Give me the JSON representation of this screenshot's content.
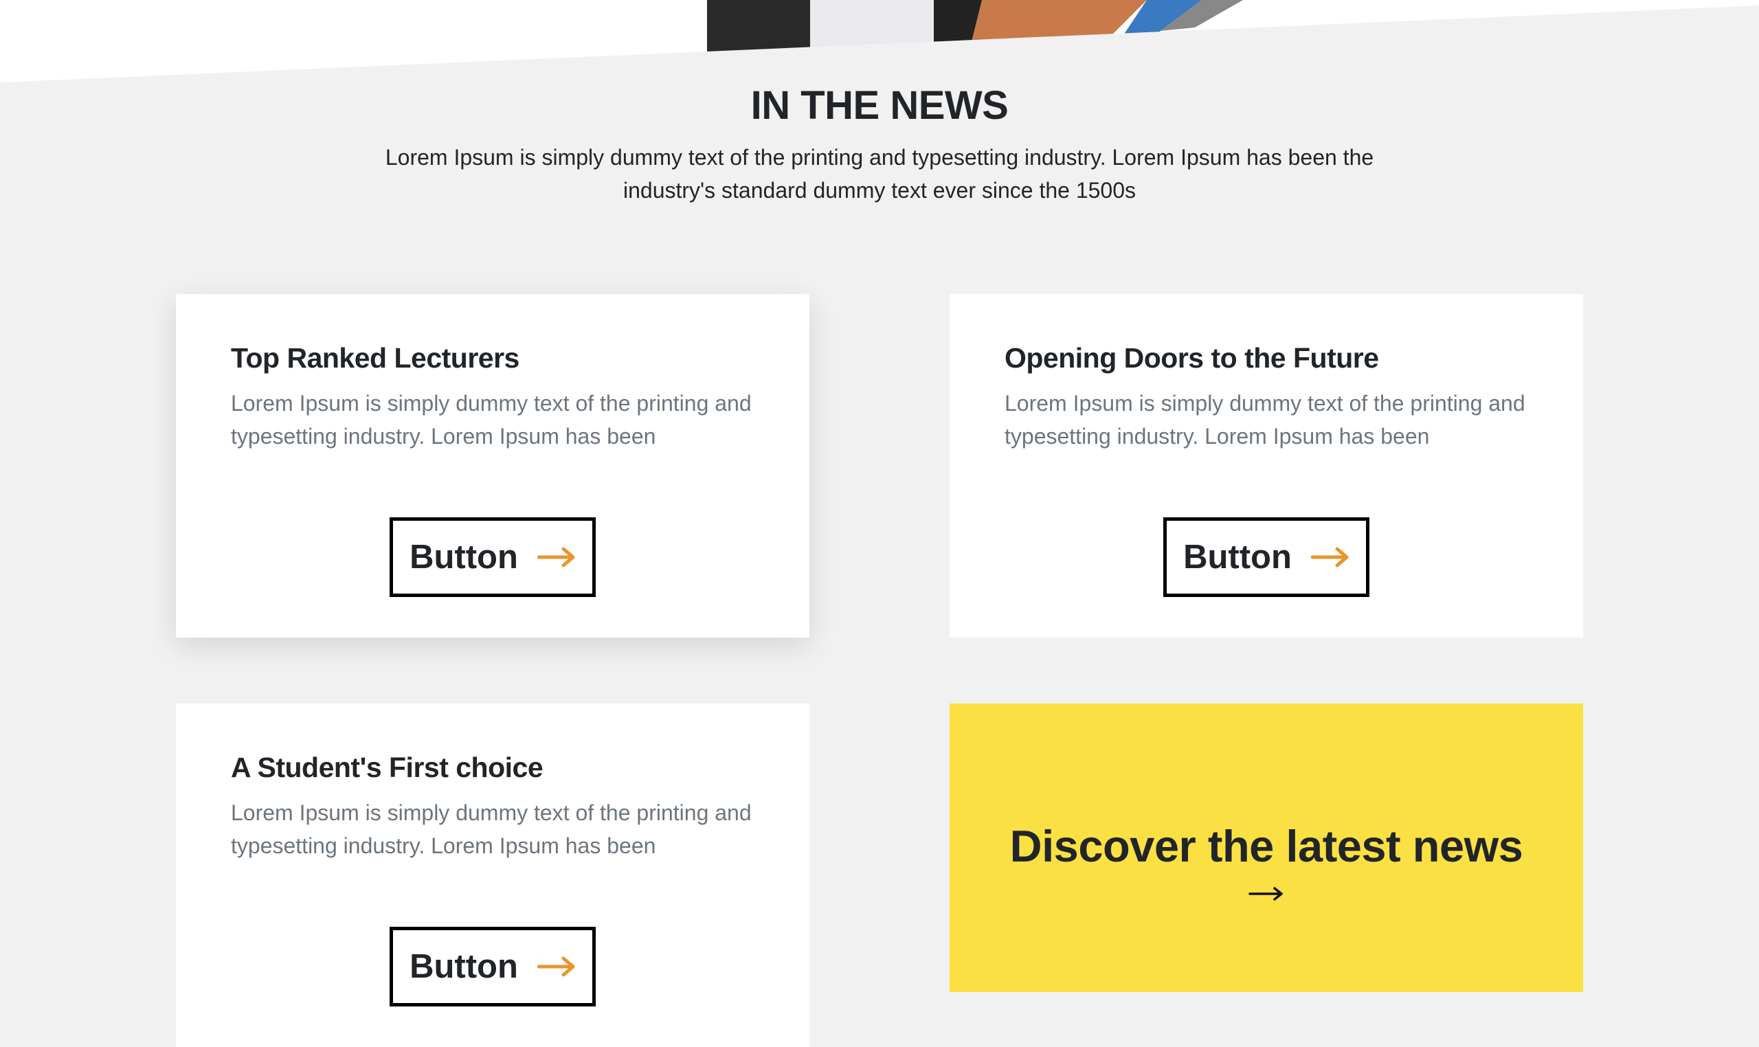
{
  "section": {
    "title": "IN THE NEWS",
    "subtitle": "Lorem Ipsum is simply dummy text of the printing and typesetting industry. Lorem Ipsum has been the industry's standard dummy text ever since the 1500s"
  },
  "cards": [
    {
      "title": "Top Ranked Lecturers",
      "text": "Lorem Ipsum is simply dummy text of the printing and typesetting industry. Lorem Ipsum has been",
      "button": "Button"
    },
    {
      "title": "Opening Doors to the Future",
      "text": "Lorem Ipsum is simply dummy text of the printing and typesetting industry. Lorem Ipsum has been",
      "button": "Button"
    },
    {
      "title": "A Student's First choice",
      "text": "Lorem Ipsum is simply dummy text of the printing and typesetting industry. Lorem Ipsum has been",
      "button": "Button"
    }
  ],
  "cta": {
    "title": "Discover the latest news",
    "icon": "arrow-right-icon"
  },
  "colors": {
    "accent": "#e8952a",
    "cta_bg": "#fbe043",
    "background": "#f1f1f1"
  }
}
